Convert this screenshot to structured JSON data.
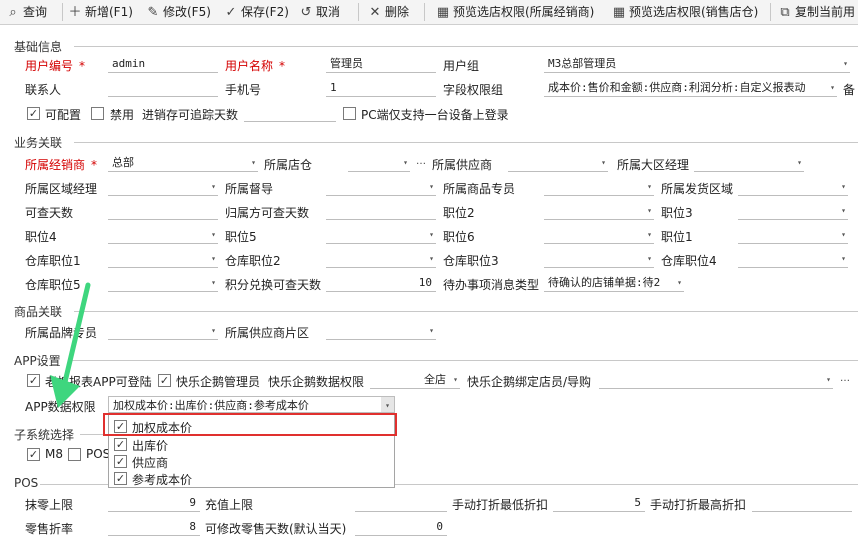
{
  "toolbar": {
    "query": "查询",
    "new": "新增(F1)",
    "edit": "修改(F5)",
    "save": "保存(F2)",
    "undo": "取消",
    "delete": "删除",
    "preview_dealer": "预览选店权限(所属经销商)",
    "preview_store": "预览选店权限(销售店仓)",
    "copy": "复制当前用"
  },
  "basic": {
    "title": "基础信息",
    "user_code_label": "用户编号",
    "user_code": "admin",
    "user_name_label": "用户名称",
    "user_name": "管理员",
    "group_label": "用户组",
    "group": "M3总部管理员",
    "contact_label": "联系人",
    "contact": "",
    "phone_label": "手机号",
    "phone": "1",
    "field_perm_label": "字段权限组",
    "field_perm": "成本价:售价和金额:供应商:利润分析:自定义报表动",
    "extra_label": "备",
    "configurable_label": "可配置",
    "disabled_label": "禁用",
    "trace_days_label": "进销存可追踪天数",
    "trace_days": "",
    "pc_single_label": "PC端仅支持一台设备上登录"
  },
  "business": {
    "title": "业务关联",
    "dealer_label": "所属经销商",
    "dealer": "总部",
    "store_label": "所属店仓",
    "supplier_label": "所属供应商",
    "region_mgr_label": "所属大区经理",
    "area_mgr_label": "所属区域经理",
    "supervisor_label": "所属督导",
    "goods_spec_label": "所属商品专员",
    "ship_region_label": "所属发货区域",
    "query_days_label": "可查天数",
    "return_days_label": "归属方可查天数",
    "pos2_label": "职位2",
    "pos3_label": "职位3",
    "pos4_label": "职位4",
    "pos5_label": "职位5",
    "pos6_label": "职位6",
    "pos1_label": "职位1",
    "wh1_label": "仓库职位1",
    "wh2_label": "仓库职位2",
    "wh3_label": "仓库职位3",
    "wh4_label": "仓库职位4",
    "wh5_label": "仓库职位5",
    "points_days_label": "积分兑换可查天数",
    "points_days": "10",
    "todo_label": "待办事项消息类型",
    "todo": "待确认的店铺单据:待2"
  },
  "goods": {
    "title": "商品关联",
    "brand_spec_label": "所属品牌专员",
    "supplier_area_label": "所属供应商片区"
  },
  "app": {
    "title": "APP设置",
    "boss_app_label": "老板报表APP可登陆",
    "penguin_admin_label": "快乐企鹅管理员",
    "penguin_perm_label": "快乐企鹅数据权限",
    "penguin_perm": "全店",
    "penguin_bind_label": "快乐企鹅绑定店员/导购",
    "data_perm_label": "APP数据权限",
    "data_perm": "加权成本价:出库价:供应商:参考成本价",
    "options": [
      "加权成本价",
      "出库价",
      "供应商",
      "参考成本价"
    ]
  },
  "subsystem": {
    "title": "子系统选择",
    "m8": "M8",
    "pos": "POS"
  },
  "pos": {
    "title": "POS",
    "round_label": "抹零上限",
    "round": "9",
    "floor_label": "充值上限",
    "floor": "",
    "manual_min_label": "手动打折最低折扣",
    "manual_min": "5",
    "manual_max_label": "手动打折最高折扣",
    "retail_label": "零售折率",
    "retail": "8",
    "modify_days_label": "可修改零售天数(默认当天)",
    "modify_days": "0"
  },
  "icons": {
    "check": "✓",
    "dropdown": "▾",
    "ellipsis": "…"
  }
}
